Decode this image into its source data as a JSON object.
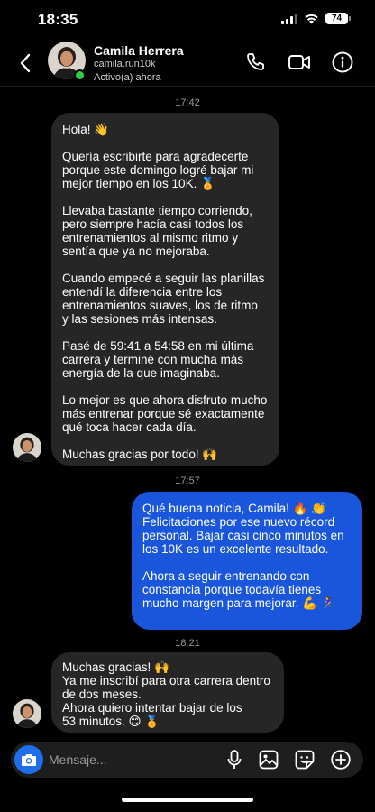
{
  "status_bar": {
    "time": "18:35",
    "battery": "74"
  },
  "header": {
    "name": "Camila Herrera",
    "username": "camila.run10k",
    "status": "Activo(a) ahora"
  },
  "conversation": {
    "timestamps": [
      "17:42",
      "17:57",
      "18:21"
    ],
    "msg1": {
      "sender": "contact",
      "paragraphs": [
        [
          "Hola! 👋"
        ],
        [
          "Quería escribirte para agradecerte",
          "porque este domingo logré bajar mi",
          "mejor tiempo en los 10K. 🏅"
        ],
        [
          "Llevaba bastante tiempo corriendo,",
          "pero siempre hacía casi todos los",
          "entrenamientos al mismo ritmo y",
          "sentía que ya no mejoraba."
        ],
        [
          "Cuando empecé a seguir las planillas",
          "entendí la diferencia entre los",
          "entrenamientos suaves, los de ritmo",
          "y las sesiones más intensas."
        ],
        [
          "Pasé de 59:41 a 54:58 en mi última",
          "carrera y terminé con mucha más",
          "energía de la que imaginaba."
        ],
        [
          "Lo mejor es que ahora disfruto mucho",
          "más entrenar porque sé exactamente",
          "qué toca hacer cada día."
        ],
        [
          "Muchas gracias por todo! 🙌"
        ]
      ]
    },
    "msg2": {
      "sender": "me",
      "paragraphs": [
        [
          "Qué buena noticia, Camila! 🔥 👏",
          "Felicitaciones por ese nuevo récord",
          "personal. Bajar casi cinco minutos en",
          "los 10K es un excelente resultado."
        ],
        [
          "Ahora a seguir entrenando con",
          "constancia porque todavía tienes",
          "mucho margen para mejorar. 💪 🏃‍♀️"
        ]
      ]
    },
    "msg3": {
      "sender": "contact",
      "paragraphs": [
        [
          "Muchas gracias! 🙌",
          "Ya me inscribí para otra carrera dentro",
          "de dos meses.",
          "Ahora quiero intentar bajar de los",
          "53 minutos. 😊 🏅"
        ]
      ]
    }
  },
  "composer": {
    "placeholder": "Mensaje..."
  },
  "colors": {
    "outgoing_bubble": "#1a56db",
    "incoming_bubble": "#262626",
    "online": "#2ecc40",
    "background": "#000000"
  }
}
